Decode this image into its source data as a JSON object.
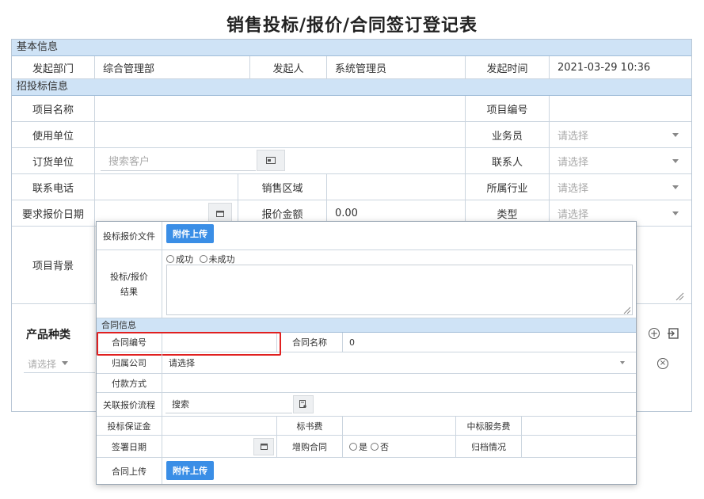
{
  "title": "销售投标/报价/合同签订登记表",
  "basic": {
    "section": "基本信息",
    "dept_label": "发起部门",
    "dept_value": "综合管理部",
    "initiator_label": "发起人",
    "initiator_value": "系统管理员",
    "time_label": "发起时间",
    "time_value": "2021-03-29 10:36"
  },
  "bid": {
    "section": "招投标信息",
    "project_name_label": "项目名称",
    "project_no_label": "项目编号",
    "user_unit_label": "使用单位",
    "salesman_label": "业务员",
    "salesman_placeholder": "请选择",
    "order_unit_label": "订货单位",
    "order_unit_placeholder": "搜索客户",
    "contact_label": "联系人",
    "contact_placeholder": "请选择",
    "phone_label": "联系电话",
    "region_label": "销售区域",
    "industry_label": "所属行业",
    "industry_placeholder": "请选择",
    "quote_date_label": "要求报价日期",
    "quote_amount_label": "报价金额",
    "quote_amount_value": "0.00",
    "type_label": "类型",
    "type_placeholder": "请选择",
    "background_label": "项目背景",
    "product_label": "产品种类",
    "product_placeholder": "请选择"
  },
  "popup": {
    "file_label": "投标报价文件",
    "upload_label": "附件上传",
    "result_label_1": "投标/报价",
    "result_label_2": "结果",
    "success_label": "成功",
    "fail_label": "未成功",
    "contract_section": "合同信息",
    "contract_no_label": "合同编号",
    "contract_name_label": "合同名称",
    "contract_name_value": "0",
    "company_label": "归属公司",
    "company_placeholder": "请选择",
    "payment_label": "付款方式",
    "flow_label": "关联报价流程",
    "flow_placeholder": "搜索",
    "deposit_label": "投标保证金",
    "bid_fee_label": "标书费",
    "service_fee_label": "中标服务费",
    "sign_date_label": "签署日期",
    "add_contract_label": "增购合同",
    "yes_label": "是",
    "no_label": "否",
    "archive_label": "归档情况",
    "contract_upload_label": "合同上传",
    "contract_upload_button": "附件上传"
  },
  "colors": {
    "section_bg": "#cfe3f6",
    "button_blue": "#3a8ee6",
    "highlight_red": "#e02020"
  }
}
